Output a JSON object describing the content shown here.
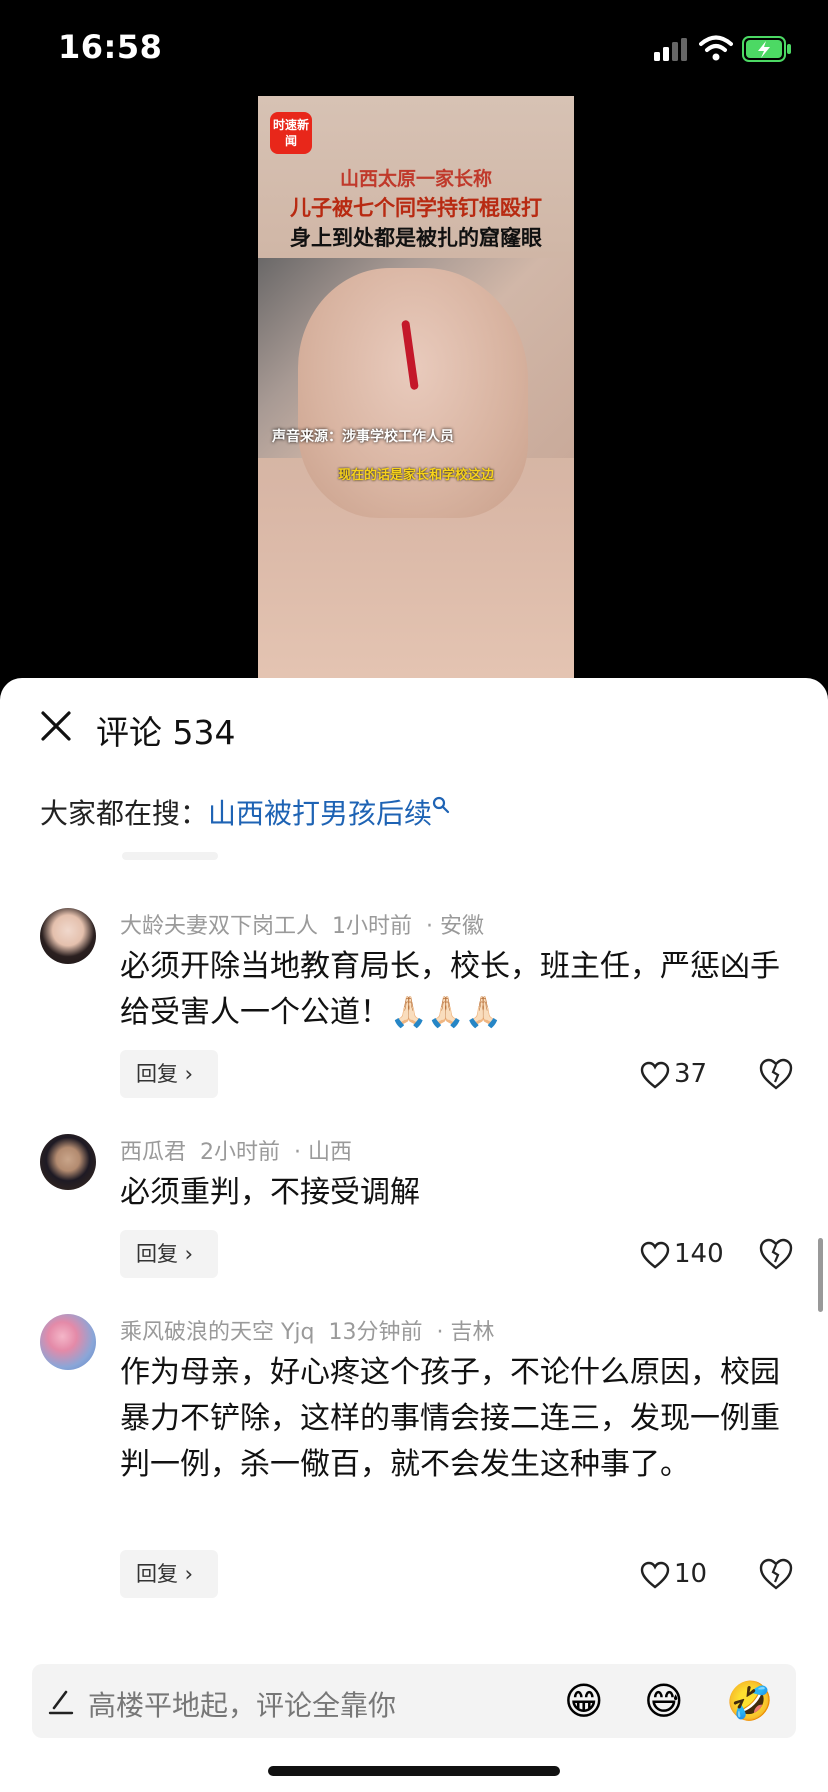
{
  "status_bar": {
    "time": "16:58"
  },
  "video": {
    "logo": "时速新闻",
    "title_lines": [
      "山西太原一家长称",
      "儿子被七个同学持钉棍殴打",
      "身上到处都是被扎的窟窿眼"
    ],
    "source_label": "声音来源：涉事学校工作人员",
    "caption": "现在的话是家长和学校这边"
  },
  "comments_header": {
    "title": "评论 534"
  },
  "search_hint": {
    "label": "大家都在搜：",
    "keyword": "山西被打男孩后续"
  },
  "comments": [
    {
      "user": "大龄夫妻双下岗工人",
      "time": "1小时前",
      "location": "安徽",
      "text": "必须开除当地教育局长，校长，班主任，严惩凶手给受害人一个公道！🙏🏻🙏🏻🙏🏻",
      "reply_label": "回复",
      "likes": "37"
    },
    {
      "user": "西瓜君",
      "time": "2小时前",
      "location": "山西",
      "text": "必须重判，不接受调解",
      "reply_label": "回复",
      "likes": "140"
    },
    {
      "user": "乘风破浪的天空 Yjq",
      "time": "13分钟前",
      "location": "吉林",
      "text": "作为母亲，好心疼这个孩子，不论什么原因，校园暴力不铲除，这样的事情会接二连三，发现一例重判一例，杀一儆百，就不会发生这种事了。",
      "reply_label": "回复",
      "likes": "10"
    }
  ],
  "input_bar": {
    "placeholder": "高楼平地起，评论全靠你",
    "emojis": [
      "😁",
      "😅",
      "🤣"
    ]
  },
  "icons": [
    "signal-icon",
    "wifi-icon",
    "battery-charging-icon",
    "close-icon",
    "search-icon",
    "heart-icon",
    "heart-broken-icon",
    "pen-icon"
  ],
  "colors": {
    "keyword": "#1e63b4",
    "sheet": "#ffffff",
    "battery": "#4cd964"
  }
}
